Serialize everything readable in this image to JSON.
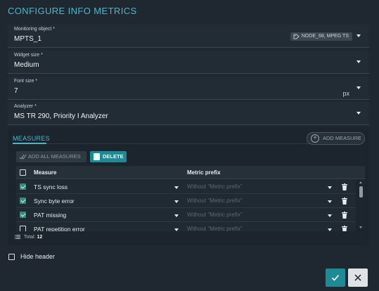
{
  "dialog": {
    "title": "CONFIGURE INFO METRICS"
  },
  "fields": {
    "monitoring_object": {
      "label": "Monitoring object *",
      "value": "MPTS_1",
      "tag": "NODE_68, MPEG TS"
    },
    "widget_size": {
      "label": "Widget size *",
      "value": "Medium"
    },
    "font_size": {
      "label": "Font size *",
      "value": "7",
      "unit": "px"
    },
    "analyzer": {
      "label": "Analyzer *",
      "value": "MS TR 290, Priority I Analyzer"
    }
  },
  "measures": {
    "title": "MEASURES",
    "add_measure_label": "ADD MEASURE",
    "add_all_label": "ADD ALL MEASURES",
    "delete_label": "DELETE",
    "columns": {
      "measure": "Measure",
      "prefix": "Metric prefix"
    },
    "rows": [
      {
        "name": "TS sync loss",
        "prefix": "Without \"Metric prefix\"",
        "checked": true
      },
      {
        "name": "Sync byte error",
        "prefix": "Without \"Metric prefix\"",
        "checked": true
      },
      {
        "name": "PAT missing",
        "prefix": "Without \"Metric prefix\"",
        "checked": true
      },
      {
        "name": "PAT repetition error",
        "prefix": "Without \"Metric prefix\"",
        "checked": false
      }
    ],
    "total_label": "Total:",
    "total_value": "12"
  },
  "hide_header": {
    "label": "Hide header",
    "checked": false
  },
  "colors": {
    "accent": "#1e8a96",
    "title": "#4fb6c9",
    "background": "#1f2830"
  }
}
